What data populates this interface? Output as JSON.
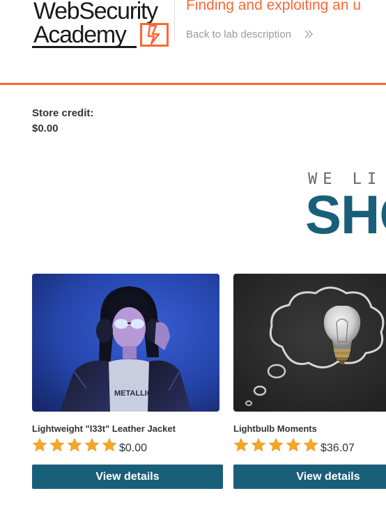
{
  "header": {
    "logo_line1": "WebSecurity",
    "logo_line2": "Academy",
    "lab_title": "Finding and exploiting an u",
    "back_link": "Back to lab description"
  },
  "store": {
    "credit_label": "Store credit:",
    "credit_value": "$0.00"
  },
  "banner": {
    "small_text": "WE LI",
    "big_text": "SHO"
  },
  "products": [
    {
      "name": "Lightweight \"l33t\" Leather Jacket",
      "price": "$0.00",
      "rating": 5,
      "button": "View details",
      "image": "person-with-headphones-image"
    },
    {
      "name": "Lightbulb Moments",
      "price": "$36.07",
      "rating": 5,
      "button": "View details",
      "image": "lightbulb-chalkboard-image"
    }
  ],
  "colors": {
    "accent": "#ff6633",
    "primary": "#1a5f79",
    "star": "#f5a623"
  }
}
